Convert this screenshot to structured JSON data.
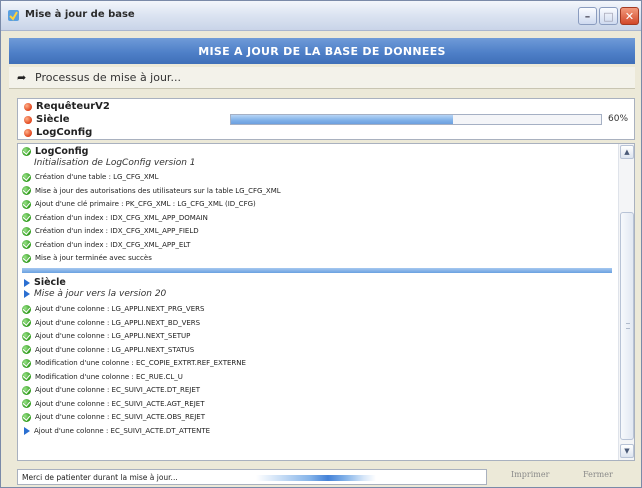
{
  "window": {
    "title": "Mise à jour de base",
    "buttons": {
      "minimize": "–",
      "maximize": "□",
      "close": "✕"
    }
  },
  "banner": {
    "text": "MISE A JOUR DE LA BASE DE DONNEES"
  },
  "process": {
    "label": "Processus de mise à jour..."
  },
  "steps": [
    {
      "label": "RequêteurV2"
    },
    {
      "label": "Siècle"
    },
    {
      "label": "LogConfig"
    }
  ],
  "progress": {
    "value_percent": 60,
    "label": "60%"
  },
  "log": {
    "section1": {
      "title": "LogConfig",
      "subtitle": "Initialisation de LogConfig version 1",
      "lines": [
        "Création d'une table : LG_CFG_XML",
        "Mise à jour des autorisations des utilisateurs sur la table LG_CFG_XML",
        "Ajout d'une clé primaire : PK_CFG_XML : LG_CFG_XML (ID_CFG)",
        "Création d'un index : IDX_CFG_XML_APP_DOMAIN",
        "Création d'un index : IDX_CFG_XML_APP_FIELD",
        "Création d'un index : IDX_CFG_XML_APP_ELT",
        "Mise à jour terminée avec succès"
      ]
    },
    "section2": {
      "title": "Siècle",
      "subtitle": "Mise à jour vers la version 20",
      "lines": [
        "Ajout d'une colonne : LG_APPLI.NEXT_PRG_VERS",
        "Ajout d'une colonne : LG_APPLI.NEXT_BD_VERS",
        "Ajout d'une colonne : LG_APPLI.NEXT_SETUP",
        "Ajout d'une colonne : LG_APPLI.NEXT_STATUS",
        "Modification d'une colonne : EC_COPIE_EXTRT.REF_EXTERNE",
        "Modification d'une colonne : EC_RUE.CL_U",
        "Ajout d'une colonne : EC_SUIVI_ACTE.DT_REJET",
        "Ajout d'une colonne : EC_SUIVI_ACTE.AGT_REJET",
        "Ajout d'une colonne : EC_SUIVI_ACTE.OBS_REJET",
        "Ajout d'une colonne : EC_SUIVI_ACTE.DT_ATTENTE"
      ]
    }
  },
  "status": {
    "text": "Merci de patienter durant la mise à jour..."
  },
  "footer": {
    "print_label": "Imprimer",
    "close_label": "Fermer"
  },
  "icons": {
    "app": "update-app-icon",
    "step": "red-dot-icon",
    "done": "green-check-icon",
    "pending": "blue-triangle-icon"
  },
  "colors": {
    "banner": "#4f80c8",
    "progress": "#7fb0e8",
    "check": "#2e9a1a",
    "step_dot": "#e0451c"
  }
}
